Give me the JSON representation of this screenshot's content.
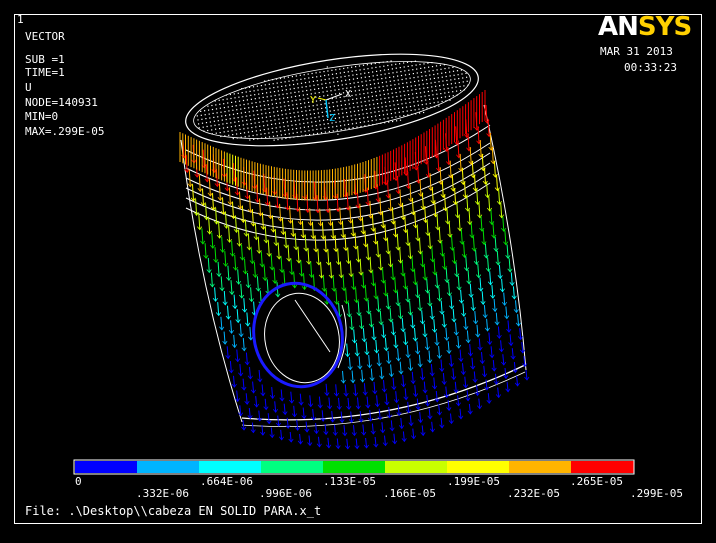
{
  "window_number": "1",
  "info": {
    "lines": [
      "VECTOR",
      "",
      "SUB =1",
      "TIME=1",
      "U",
      "NODE=140931",
      "MIN=0",
      "MAX=.299E-05"
    ]
  },
  "logo": {
    "text_a": "AN",
    "text_b": "SYS"
  },
  "date": "MAR 31 2013",
  "time": "00:33:23",
  "triad": {
    "x_label": "X",
    "y_label": "Y",
    "z_label": "Z"
  },
  "legend": {
    "colors": [
      "#0000ff",
      "#00b4ff",
      "#00ffff",
      "#00ff80",
      "#00e000",
      "#c8ff00",
      "#ffff00",
      "#ffb400",
      "#ff0000"
    ],
    "top_labels": [
      "0",
      ".664E-06",
      ".133E-05",
      ".199E-05",
      ".265E-05"
    ],
    "bottom_labels": [
      ".332E-06",
      ".996E-06",
      ".166E-05",
      ".232E-05",
      ".299E-05"
    ]
  },
  "file_line": "File: .\\Desktop\\\\cabeza EN SOLID PARA.x_t"
}
